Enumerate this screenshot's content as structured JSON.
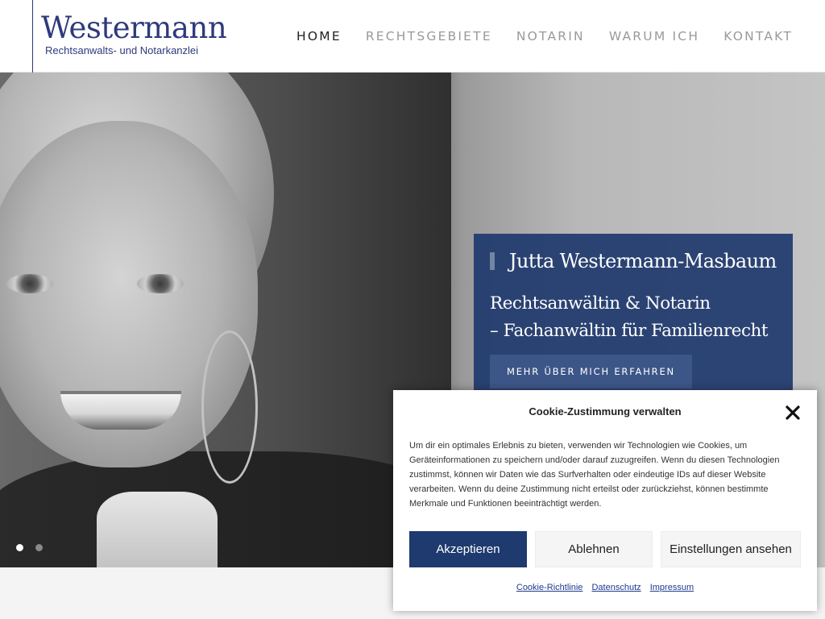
{
  "logo": {
    "name": "Westermann",
    "subtitle": "Rechtsanwalts- und Notarkanzlei"
  },
  "nav": {
    "items": [
      {
        "label": "HOME",
        "active": true
      },
      {
        "label": "RECHTSGEBIETE",
        "active": false
      },
      {
        "label": "NOTARIN",
        "active": false
      },
      {
        "label": "WARUM ICH",
        "active": false
      },
      {
        "label": "KONTAKT",
        "active": false
      }
    ]
  },
  "hero": {
    "title": "Jutta Westermann-Masbaum",
    "line1": "Rechtsanwältin & Notarin",
    "line2": "– Fachanwältin für Familienrecht",
    "button": "MEHR ÜBER MICH ERFAHREN",
    "slides": {
      "count": 2,
      "active": 1
    }
  },
  "cookie": {
    "title": "Cookie-Zustimmung verwalten",
    "text": "Um dir ein optimales Erlebnis zu bieten, verwenden wir Technologien wie Cookies, um Geräteinformationen zu speichern und/oder darauf zuzugreifen. Wenn du diesen Technologien zustimmst, können wir Daten wie das Surfverhalten oder eindeutige IDs auf dieser Website verarbeiten. Wenn du deine Zustimmung nicht erteilst oder zurückziehst, können bestimmte Merkmale und Funktionen beeinträchtigt werden.",
    "accept": "Akzeptieren",
    "deny": "Ablehnen",
    "settings": "Einstellungen ansehen",
    "links": [
      "Cookie-Richtlinie",
      "Datenschutz",
      "Impressum"
    ]
  },
  "colors": {
    "brand": "#2e3a7c",
    "caption_bg": "#203a6e",
    "accept_bg": "#1e3a6e",
    "link": "#1e3a8e"
  }
}
